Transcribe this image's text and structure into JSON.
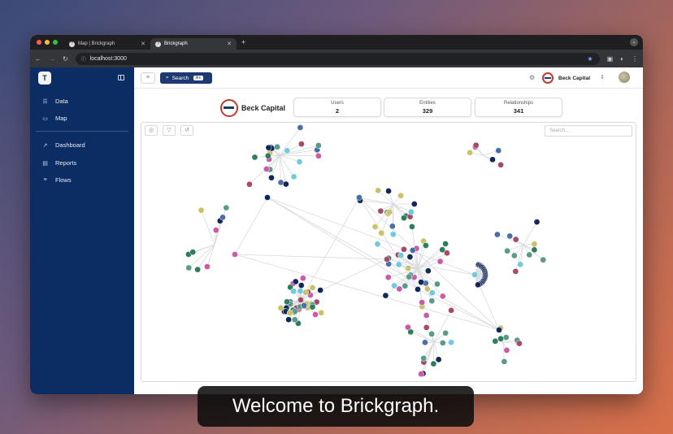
{
  "browser": {
    "tabs": [
      {
        "label": "Map | Brickgraph",
        "active": false
      },
      {
        "label": "Brickgraph",
        "active": true
      }
    ],
    "new_tab": "+",
    "url": "localhost:3000"
  },
  "sidebar": {
    "logo": "T",
    "items": [
      {
        "label": "Data",
        "icon": "database-icon",
        "glyph": "☰"
      },
      {
        "label": "Map",
        "icon": "map-icon",
        "glyph": "▭"
      },
      {
        "label": "Dashboard",
        "icon": "trend-icon",
        "glyph": "↗"
      },
      {
        "label": "Reports",
        "icon": "report-icon",
        "glyph": "▤"
      },
      {
        "label": "Flows",
        "icon": "flows-icon",
        "glyph": "≡"
      }
    ]
  },
  "topbar": {
    "search_label": "Search",
    "search_shortcut": "⌘K",
    "org_name": "Beck Capital"
  },
  "header": {
    "company": "Beck Capital",
    "stats": [
      {
        "label": "Users",
        "value": "2"
      },
      {
        "label": "Entities",
        "value": "329"
      },
      {
        "label": "Relationships",
        "value": "341"
      }
    ]
  },
  "graph": {
    "search_placeholder": "Search...",
    "node_colors": [
      "#2e7d5b",
      "#5a9a8a",
      "#6fcadc",
      "#c9c26a",
      "#4a6fa5",
      "#13285a",
      "#a64a6a",
      "#cc5aa8"
    ]
  },
  "caption": "Welcome to Brickgraph."
}
